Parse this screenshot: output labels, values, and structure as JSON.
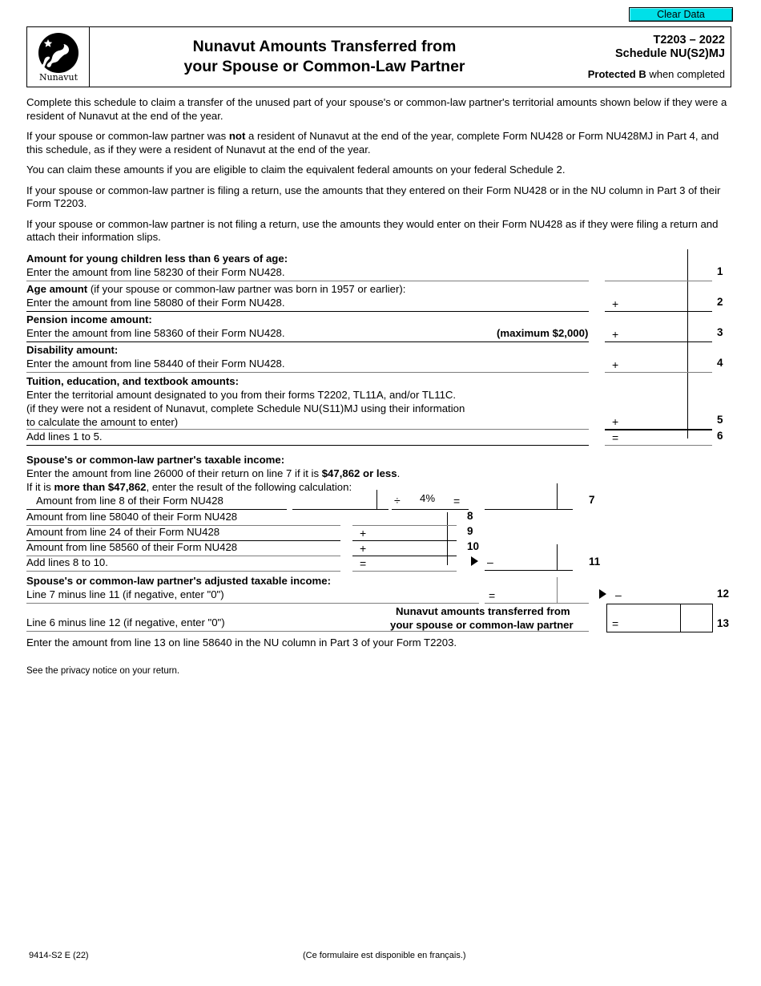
{
  "toolbar": {
    "clear_data_label": "Clear Data"
  },
  "header": {
    "logo_name": "Nunavut",
    "title_line1": "Nunavut Amounts Transferred from",
    "title_line2": "your Spouse or Common-Law Partner",
    "form_code": "T2203 – 2022",
    "schedule": "Schedule NU(S2)MJ",
    "protected_bold": "Protected B",
    "protected_rest": " when completed"
  },
  "intro": {
    "p1": "Complete this schedule to claim a transfer of the unused part of your spouse's or common-law partner's territorial amounts shown below if they were a resident of Nunavut at the end of the year.",
    "p2_a": "If your spouse or common-law partner was ",
    "p2_b": "not",
    "p2_c": " a resident of Nunavut at the end of the year, complete Form NU428 or Form NU428MJ in Part 4, and this schedule, as if they were a resident of Nunavut at the end of the year.",
    "p3": "You can claim these amounts if you are eligible to claim the equivalent federal amounts on your federal Schedule 2.",
    "p4": "If your spouse or common-law partner is filing a return, use the amounts that they entered on their Form NU428 or in the NU column in Part 3 of their Form T2203.",
    "p5": "If your spouse or common-law partner is not filing a return, use the amounts they would enter on their Form NU428 as if they were filing a return and attach their information slips."
  },
  "section1": {
    "row1": {
      "heading": "Amount for young children less than 6 years of age:",
      "text": "Enter the amount from line 58230 of their Form NU428.",
      "line_no": "1",
      "value": ""
    },
    "row2": {
      "heading_bold": "Age amount",
      "heading_rest": " (if your spouse or common-law partner was born in 1957 or earlier):",
      "text": "Enter the amount from line 58080 of their Form NU428.",
      "operator": "+",
      "line_no": "2",
      "value": ""
    },
    "row3": {
      "heading": "Pension income amount:",
      "text": "Enter the amount from line 58360 of their Form NU428.",
      "note": "(maximum $2,000)",
      "operator": "+",
      "line_no": "3",
      "value": ""
    },
    "row4": {
      "heading": "Disability amount:",
      "text": "Enter the amount from line 58440 of their Form NU428.",
      "operator": "+",
      "line_no": "4",
      "value": ""
    },
    "row5": {
      "heading": "Tuition, education, and textbook amounts:",
      "text1": "Enter the territorial amount designated to you from their forms T2202, TL11A, and/or TL11C.",
      "text2": "(if they were not a resident of Nunavut, complete Schedule NU(S11)MJ using their information",
      "text3": "to calculate the amount to enter)",
      "operator": "+",
      "line_no": "5",
      "value": ""
    },
    "row6": {
      "text": "Add lines 1 to 5.",
      "operator": "=",
      "line_no": "6",
      "value": ""
    }
  },
  "section2": {
    "heading": "Spouse's or common-law partner's taxable income:",
    "sub1_a": "Enter the amount from line 26000 of their return on line 7 if it is ",
    "sub1_b": "$47,862 or less",
    "sub1_c": ".",
    "sub2_a": "If it is ",
    "sub2_b": "more than $47,862",
    "sub2_c": ", enter the result of the following calculation:",
    "row7": {
      "text": "Amount from line 8 of their Form NU428",
      "divide": "÷",
      "rate": "4%",
      "equals": "=",
      "line_no": "7",
      "value_a": "",
      "value_b": "",
      "value_result": ""
    },
    "row8": {
      "text": "Amount from line 58040 of their Form NU428",
      "operator": "",
      "line_no": "8",
      "value": ""
    },
    "row9": {
      "text": "Amount from line 24 of their Form NU428",
      "operator": "+",
      "line_no": "9",
      "value": ""
    },
    "row10": {
      "text": "Amount from line 58560 of their Form NU428",
      "operator": "+",
      "line_no": "10",
      "value": ""
    },
    "row11": {
      "text": "Add lines 8 to 10.",
      "operator": "=",
      "minus": "–",
      "line_no": "11",
      "value": "",
      "value_carry": ""
    },
    "row12": {
      "heading": "Spouse's or common-law partner's adjusted taxable income:",
      "text": "Line 7 minus line 11 (if negative, enter \"0\")",
      "operator": "=",
      "minus": "–",
      "line_no": "12",
      "value": "",
      "value_carry": ""
    },
    "row13": {
      "text": "Line 6 minus line 12 (if negative, enter \"0\")",
      "label_line1": "Nunavut amounts transferred from",
      "label_line2": "your spouse or common-law partner",
      "operator": "=",
      "line_no": "13",
      "value": ""
    }
  },
  "closing": {
    "instruction": "Enter the amount from line 13 on line 58640 in the NU column in Part 3 of your Form T2203.",
    "privacy": "See the privacy notice on your return."
  },
  "footer": {
    "form_id": "9414-S2 E (22)",
    "french_note": "(Ce formulaire est disponible en français.)"
  }
}
